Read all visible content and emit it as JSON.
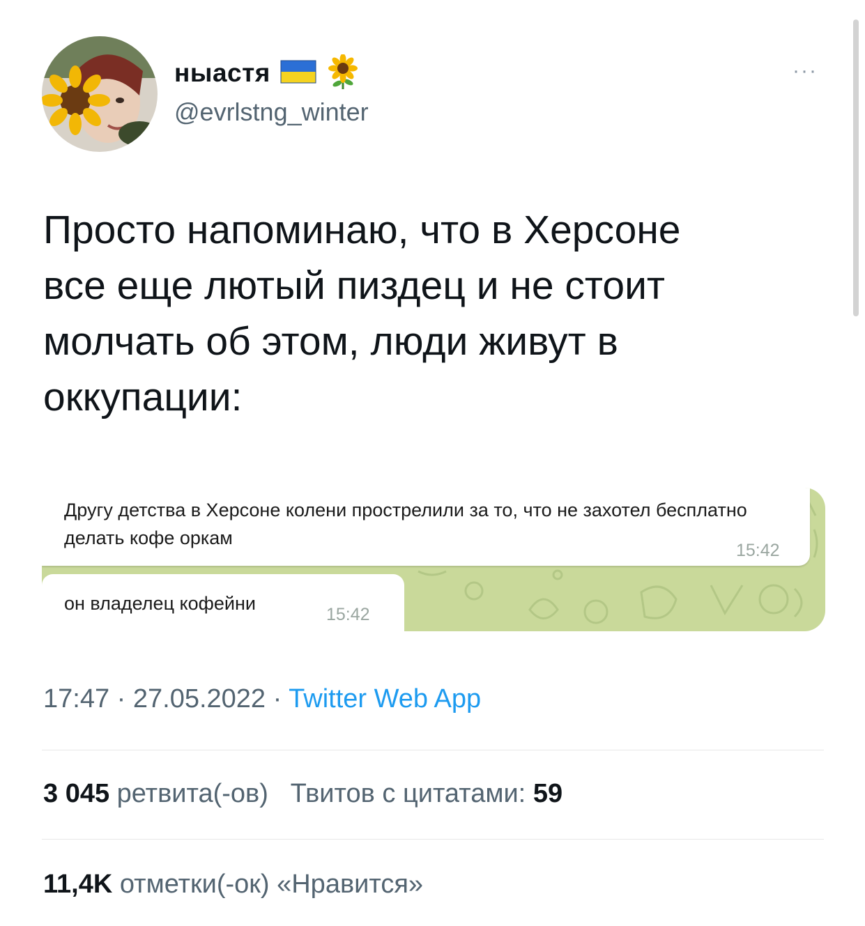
{
  "author": {
    "display_name": "ныастя",
    "handle": "@evrlstng_winter",
    "flag_icon": "ukraine-flag-icon",
    "emoji_icon": "sunflower-icon"
  },
  "more_label": "···",
  "tweet_lines": [
    "Просто напоминаю, что в Херсоне",
    "все еще лютый пиздец и не стоит",
    "молчать об этом, люди живут в",
    "оккупации:"
  ],
  "media": {
    "messages": [
      {
        "text": "Другу детства в Херсоне колени прострелили за то, что не захотел бесплатно делать кофе оркам",
        "time": "15:42"
      },
      {
        "text": "он владелец кофейни",
        "time": "15:42"
      }
    ]
  },
  "meta": {
    "time": "17:47",
    "date": "27.05.2022",
    "separator": " · ",
    "source": "Twitter Web App"
  },
  "stats": {
    "retweets_count": "3 045",
    "retweets_label": "ретвита(-ов)",
    "quotes_label": "Твитов с цитатами:",
    "quotes_count": "59",
    "likes_count": "11,4K",
    "likes_label": "отметки(-ок) «Нравится»"
  },
  "colors": {
    "link": "#1d9bf0",
    "secondary_text": "#536471",
    "chat_background": "#c9d99a"
  }
}
